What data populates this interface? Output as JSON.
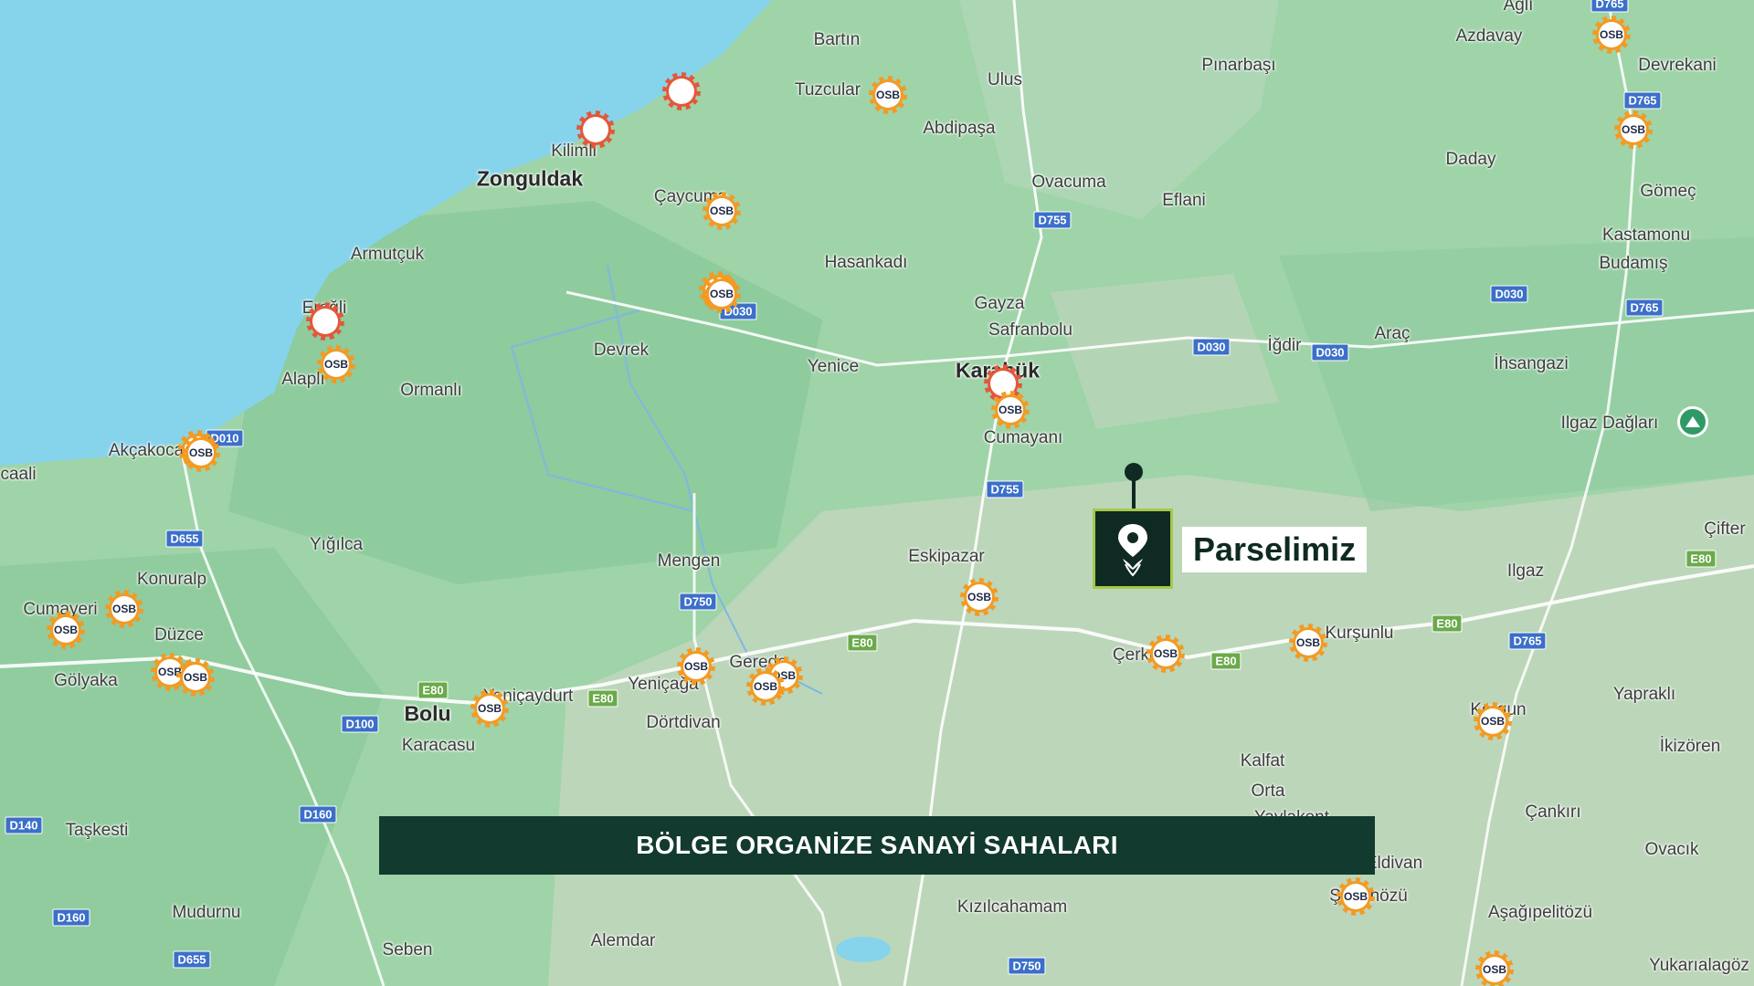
{
  "map": {
    "colors": {
      "sea": "#86d3ec",
      "land": "#9fd3a8",
      "forest": "#84c796",
      "relief": "#c9d7c2",
      "road": "#ffffff",
      "shield_blue": "#3b6fc9",
      "shield_green": "#6aaa4a",
      "osb_orange": "#f39a22",
      "osb_red": "#e4573a",
      "pin": "#0e2a22",
      "pin_border": "#a6c94a"
    },
    "places": [
      {
        "id": "bartin",
        "name": "Bartın",
        "big": false
      },
      {
        "id": "agli",
        "name": "Ağlı",
        "big": false
      },
      {
        "id": "azdavay",
        "name": "Azdavay",
        "big": false
      },
      {
        "id": "devrekani",
        "name": "Devrekani",
        "big": false
      },
      {
        "id": "tuzcular",
        "name": "Tuzcular",
        "big": false
      },
      {
        "id": "ulus",
        "name": "Ulus",
        "big": false
      },
      {
        "id": "pinarbasi",
        "name": "Pınarbaşı",
        "big": false
      },
      {
        "id": "abdipasa",
        "name": "Abdipaşa",
        "big": false
      },
      {
        "id": "kilimli",
        "name": "Kilimli",
        "big": false
      },
      {
        "id": "zonguldak",
        "name": "Zonguldak",
        "big": true
      },
      {
        "id": "caycuma",
        "name": "Çaycuma",
        "big": false
      },
      {
        "id": "ovacuma",
        "name": "Ovacuma",
        "big": false
      },
      {
        "id": "eflani",
        "name": "Eflani",
        "big": false
      },
      {
        "id": "daday",
        "name": "Daday",
        "big": false
      },
      {
        "id": "gomec",
        "name": "Gömeç",
        "big": false
      },
      {
        "id": "kastamonu",
        "name": "Kastamonu",
        "big": false
      },
      {
        "id": "budamis",
        "name": "Budamış",
        "big": false
      },
      {
        "id": "armutcuk",
        "name": "Armutçuk",
        "big": false
      },
      {
        "id": "hasankadi",
        "name": "Hasankadı",
        "big": false
      },
      {
        "id": "gayza",
        "name": "Gayza",
        "big": false
      },
      {
        "id": "safranbolu",
        "name": "Safranbolu",
        "big": false
      },
      {
        "id": "eregli",
        "name": "Ereğli",
        "big": false
      },
      {
        "id": "devrek",
        "name": "Devrek",
        "big": false
      },
      {
        "id": "yenice",
        "name": "Yenice",
        "big": false
      },
      {
        "id": "karabuk",
        "name": "Karabük",
        "big": true
      },
      {
        "id": "igdir",
        "name": "İğdir",
        "big": false
      },
      {
        "id": "arac",
        "name": "Araç",
        "big": false
      },
      {
        "id": "ihsangazi",
        "name": "İhsangazi",
        "big": false
      },
      {
        "id": "alapli",
        "name": "Alaplı",
        "big": false
      },
      {
        "id": "ormanli",
        "name": "Ormanlı",
        "big": false
      },
      {
        "id": "cumayani",
        "name": "Cumayanı",
        "big": false
      },
      {
        "id": "ilgazdaglari",
        "name": "Ilgaz Dağları",
        "big": false
      },
      {
        "id": "akcakoca",
        "name": "Akçakoca",
        "big": false
      },
      {
        "id": "caali",
        "name": "caali",
        "big": false
      },
      {
        "id": "yigilca",
        "name": "Yığılca",
        "big": false
      },
      {
        "id": "eskipazar",
        "name": "Eskipazar",
        "big": false
      },
      {
        "id": "mengen",
        "name": "Mengen",
        "big": false
      },
      {
        "id": "ilgaz",
        "name": "Ilgaz",
        "big": false
      },
      {
        "id": "cifter",
        "name": "Çifter",
        "big": false
      },
      {
        "id": "konuralp",
        "name": "Konuralp",
        "big": false
      },
      {
        "id": "cumayeri",
        "name": "Cumayeri",
        "big": false
      },
      {
        "id": "duzce",
        "name": "Düzce",
        "big": false
      },
      {
        "id": "kursunlu",
        "name": "Kurşunlu",
        "big": false
      },
      {
        "id": "cerkes",
        "name": "Çerkeş",
        "big": false
      },
      {
        "id": "golyaka",
        "name": "Gölyaka",
        "big": false
      },
      {
        "id": "gerede",
        "name": "Gerede",
        "big": false
      },
      {
        "id": "yenicaga",
        "name": "Yeniçağa",
        "big": false
      },
      {
        "id": "yenicaydurt",
        "name": "Yeniçaydurt",
        "big": false
      },
      {
        "id": "bolu",
        "name": "Bolu",
        "big": true
      },
      {
        "id": "yaprakli",
        "name": "Yapraklı",
        "big": false
      },
      {
        "id": "korgun",
        "name": "Korgun",
        "big": false
      },
      {
        "id": "dortdivan",
        "name": "Dörtdivan",
        "big": false
      },
      {
        "id": "karacasu",
        "name": "Karacasu",
        "big": false
      },
      {
        "id": "ikizoren",
        "name": "İkizören",
        "big": false
      },
      {
        "id": "kalfat",
        "name": "Kalfat",
        "big": false
      },
      {
        "id": "orta",
        "name": "Orta",
        "big": false
      },
      {
        "id": "yaylakent",
        "name": "Yaylakent",
        "big": false
      },
      {
        "id": "cankiri",
        "name": "Çankırı",
        "big": false
      },
      {
        "id": "taskesti",
        "name": "Taşkesti",
        "big": false
      },
      {
        "id": "eldivan",
        "name": "Eldivan",
        "big": false
      },
      {
        "id": "ovacik",
        "name": "Ovacık",
        "big": false
      },
      {
        "id": "kizilcahamam",
        "name": "Kızılcahamam",
        "big": false
      },
      {
        "id": "sabanozu",
        "name": "Şabanözü",
        "big": false
      },
      {
        "id": "asagipelitozu",
        "name": "Aşağıpelitözü",
        "big": false
      },
      {
        "id": "mudurnu",
        "name": "Mudurnu",
        "big": false
      },
      {
        "id": "alemdar",
        "name": "Alemdar",
        "big": false
      },
      {
        "id": "seben",
        "name": "Seben",
        "big": false
      },
      {
        "id": "yukarialagoz",
        "name": "Yukarıalagöz",
        "big": false
      }
    ],
    "roads": [
      {
        "id": "d765a",
        "code": "D765",
        "type": "blue"
      },
      {
        "id": "d765b",
        "code": "D765",
        "type": "blue"
      },
      {
        "id": "d755a",
        "code": "D755",
        "type": "blue"
      },
      {
        "id": "d030a",
        "code": "D030",
        "type": "blue"
      },
      {
        "id": "d765c",
        "code": "D765",
        "type": "blue"
      },
      {
        "id": "d030b",
        "code": "D030",
        "type": "blue"
      },
      {
        "id": "d030c",
        "code": "D030",
        "type": "blue"
      },
      {
        "id": "d030d",
        "code": "D030",
        "type": "blue"
      },
      {
        "id": "d010",
        "code": "D010",
        "type": "blue"
      },
      {
        "id": "d755b",
        "code": "D755",
        "type": "blue"
      },
      {
        "id": "d655a",
        "code": "D655",
        "type": "blue"
      },
      {
        "id": "e80a",
        "code": "E80",
        "type": "green"
      },
      {
        "id": "e80b",
        "code": "E80",
        "type": "green"
      },
      {
        "id": "d750a",
        "code": "D750",
        "type": "blue"
      },
      {
        "id": "e80c",
        "code": "E80",
        "type": "green"
      },
      {
        "id": "e80d",
        "code": "E80",
        "type": "green"
      },
      {
        "id": "e80e",
        "code": "E80",
        "type": "green"
      },
      {
        "id": "e80f",
        "code": "E80",
        "type": "green"
      },
      {
        "id": "d765d",
        "code": "D765",
        "type": "blue"
      },
      {
        "id": "d100",
        "code": "D100",
        "type": "blue"
      },
      {
        "id": "d160a",
        "code": "D160",
        "type": "blue"
      },
      {
        "id": "d140",
        "code": "D140",
        "type": "blue"
      },
      {
        "id": "d160b",
        "code": "D160",
        "type": "blue"
      },
      {
        "id": "d655b",
        "code": "D655",
        "type": "blue"
      },
      {
        "id": "d750b",
        "code": "D750",
        "type": "blue"
      }
    ],
    "osb_label": "OSB",
    "osb_markers": [
      {
        "id": "m1",
        "kind": "osb"
      },
      {
        "id": "m2",
        "kind": "osb"
      },
      {
        "id": "m3",
        "kind": "osb"
      },
      {
        "id": "m4",
        "kind": "red"
      },
      {
        "id": "m5",
        "kind": "red"
      },
      {
        "id": "m6",
        "kind": "osb"
      },
      {
        "id": "m7",
        "kind": "osb"
      },
      {
        "id": "m8",
        "kind": "osb"
      },
      {
        "id": "m9",
        "kind": "red"
      },
      {
        "id": "m10",
        "kind": "osb"
      },
      {
        "id": "m11",
        "kind": "red"
      },
      {
        "id": "m12",
        "kind": "osb"
      },
      {
        "id": "m13",
        "kind": "osb"
      },
      {
        "id": "m14",
        "kind": "osb"
      },
      {
        "id": "m15",
        "kind": "osb"
      },
      {
        "id": "m16",
        "kind": "osb"
      },
      {
        "id": "m17",
        "kind": "osb"
      },
      {
        "id": "m18",
        "kind": "osb"
      },
      {
        "id": "m19",
        "kind": "osb"
      },
      {
        "id": "m20",
        "kind": "osb"
      },
      {
        "id": "m21",
        "kind": "osb"
      },
      {
        "id": "m22",
        "kind": "osb"
      },
      {
        "id": "m23",
        "kind": "osb"
      },
      {
        "id": "m24",
        "kind": "osb"
      },
      {
        "id": "m25",
        "kind": "osb"
      },
      {
        "id": "m26",
        "kind": "osb"
      },
      {
        "id": "m27",
        "kind": "osb"
      },
      {
        "id": "m28",
        "kind": "osb"
      }
    ]
  },
  "pin": {
    "label": "Parselimiz",
    "icon": "location-leaf-icon"
  },
  "park": {
    "icon": "mountain-icon"
  },
  "banner": {
    "title": "BÖLGE ORGANİZE SANAYİ SAHALARI"
  }
}
